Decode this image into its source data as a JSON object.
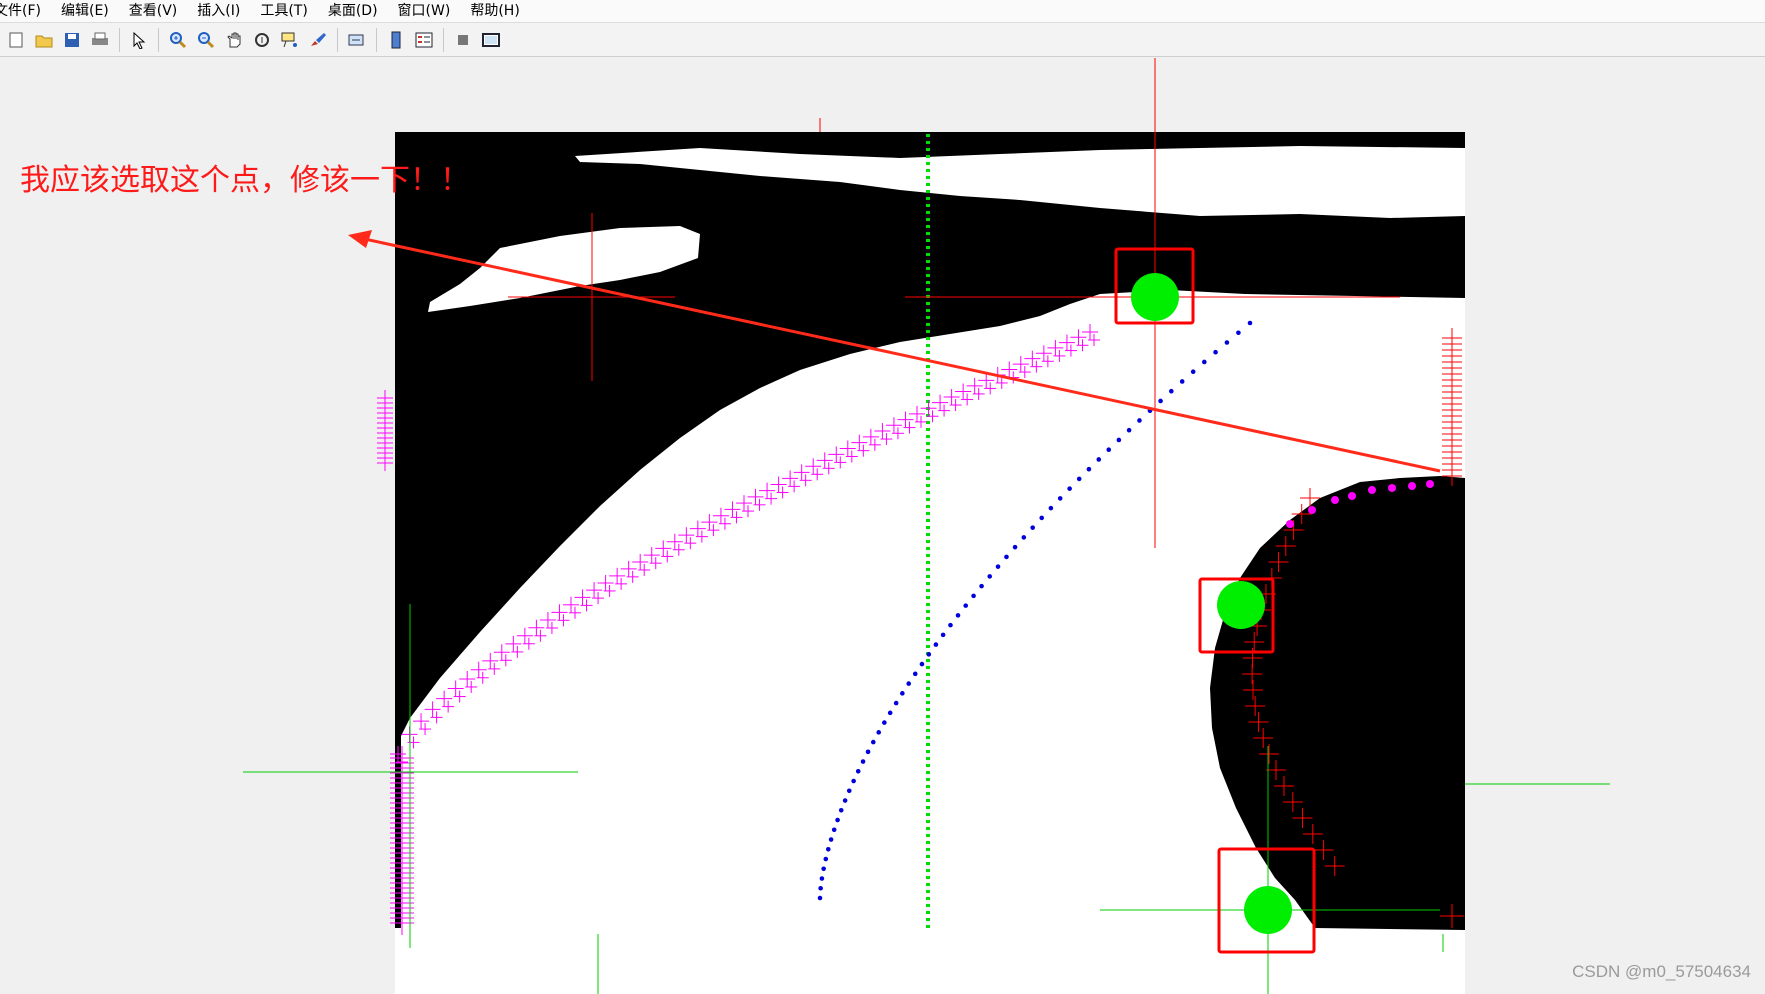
{
  "menubar": {
    "items": [
      "文件(F)",
      "编辑(E)",
      "查看(V)",
      "插入(I)",
      "工具(T)",
      "桌面(D)",
      "窗口(W)",
      "帮助(H)"
    ]
  },
  "toolbar": {
    "icons": [
      "new-file-icon",
      "open-folder-icon",
      "save-icon",
      "print-icon",
      "pointer-icon",
      "zoom-in-icon",
      "zoom-out-icon",
      "pan-hand-icon",
      "rotate-3d-icon",
      "data-cursor-icon",
      "brush-icon",
      "link-plot-icon",
      "colorbar-icon",
      "legend-icon",
      "hide-tools-icon",
      "dock-figure-icon"
    ]
  },
  "annotation": {
    "text": "我应该选取这个点，修该一下！！",
    "color": "#ff1a1a"
  },
  "watermark": {
    "text": "CSDN @m0_57504634"
  },
  "colors": {
    "marker_green": "#00ee00",
    "box_red": "#ff0000",
    "cross_magenta": "#ff00ff",
    "dots_blue": "#0000dd",
    "crosshair_red": "#ff0000",
    "crosshair_green": "#00cc00"
  }
}
